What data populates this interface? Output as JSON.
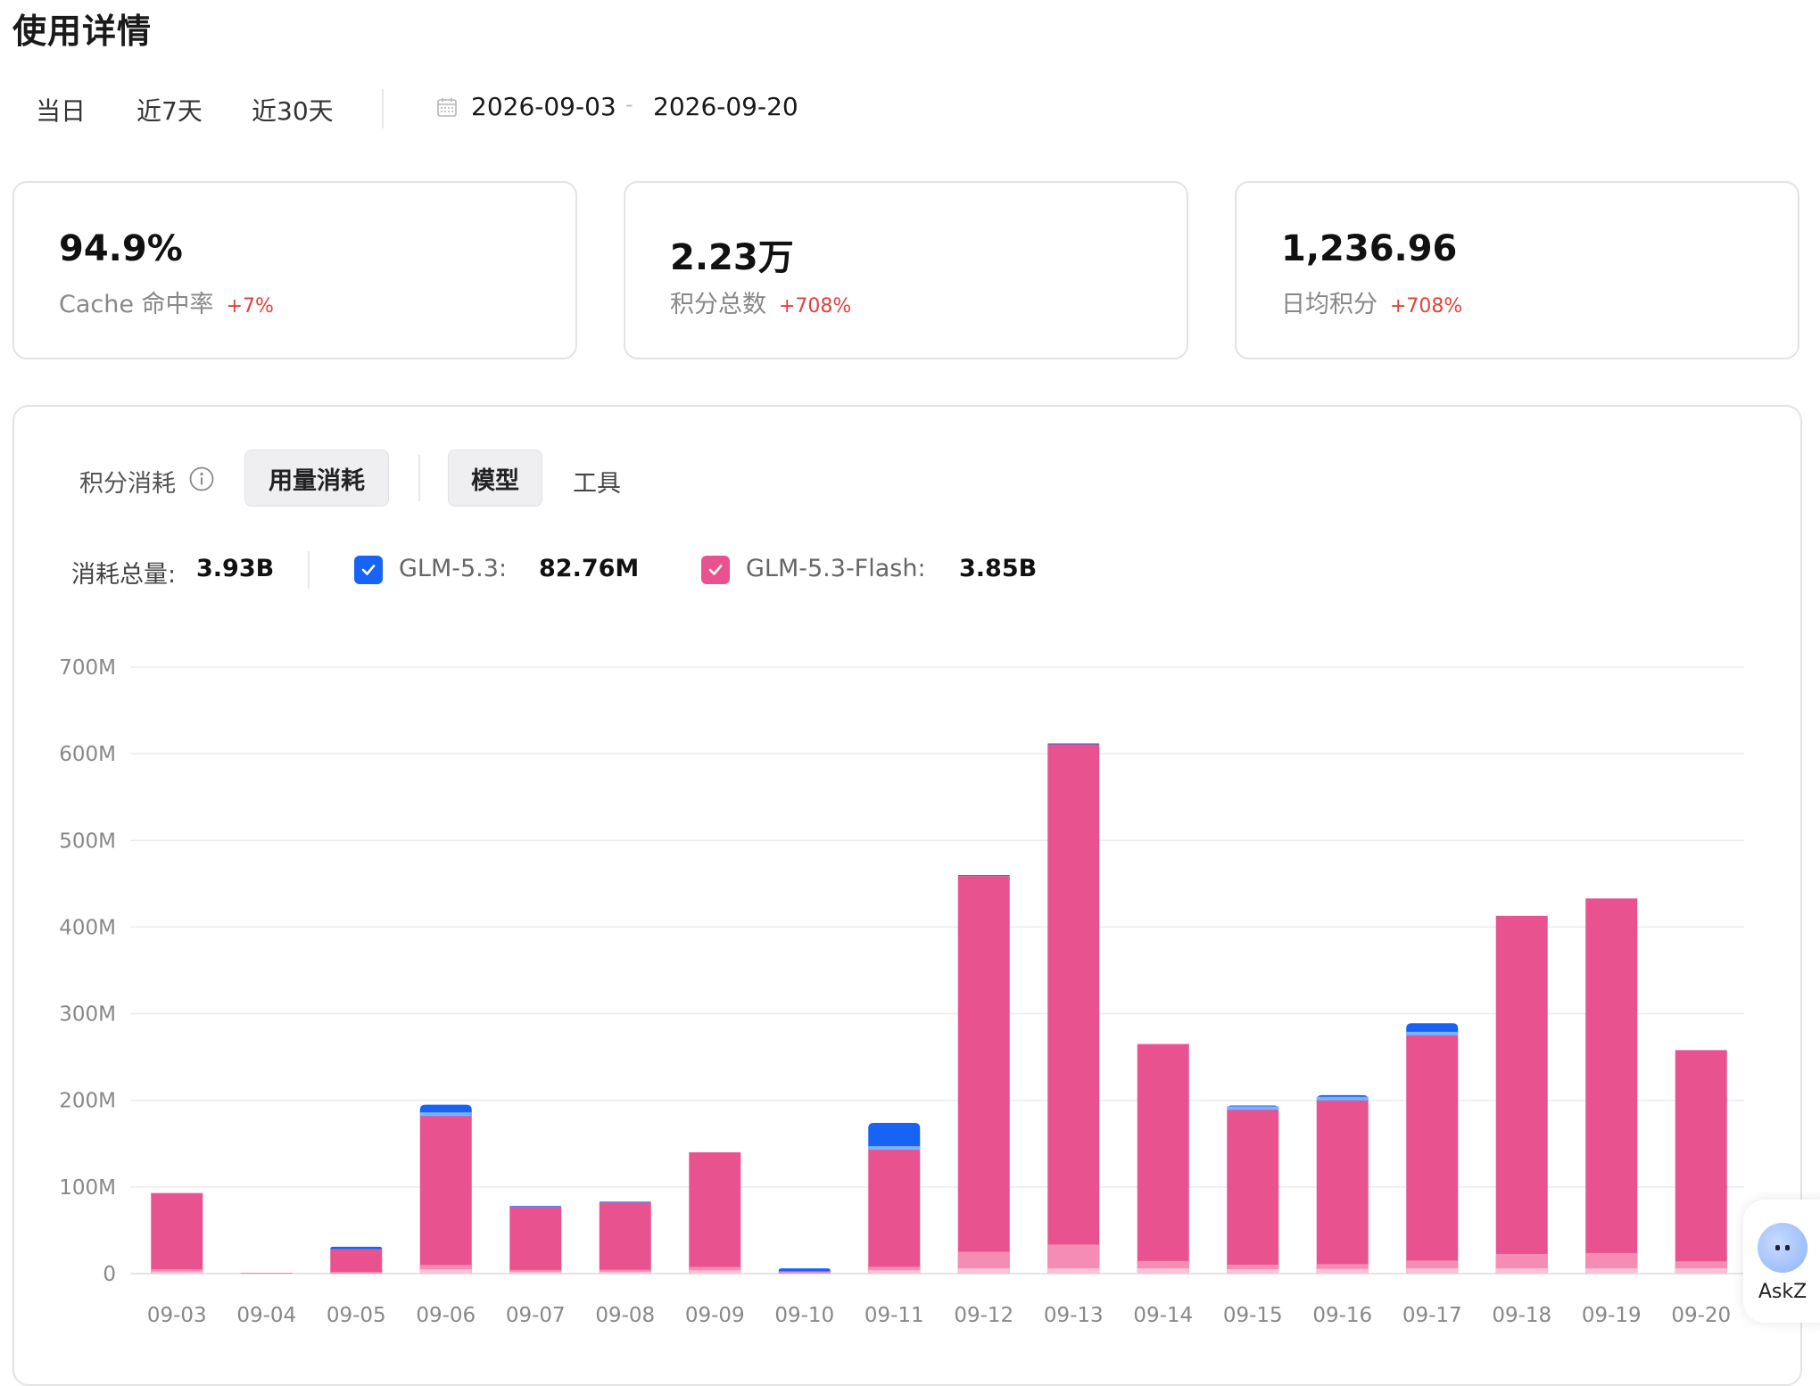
{
  "page": {
    "title": "使用详情"
  },
  "range": {
    "tabs": [
      "当日",
      "近7天",
      "近30天"
    ],
    "start": "2026-09-03",
    "separator": "-",
    "end": "2026-09-20"
  },
  "stats": [
    {
      "value": "94.9%",
      "label": "Cache 命中率",
      "change": "+7%"
    },
    {
      "value": "2.23万",
      "label": "积分总数",
      "change": "+708%"
    },
    {
      "value": "1,236.96",
      "label": "日均积分",
      "change": "+708%"
    }
  ],
  "panel": {
    "points_label": "积分消耗",
    "usage_btn": "用量消耗",
    "model_btn": "模型",
    "tool_tab": "工具"
  },
  "summary": {
    "total_label": "消耗总量:",
    "total_value": "3.93B",
    "series": [
      {
        "name": "GLM-5.3:",
        "value": "82.76M",
        "checked": true,
        "color": "#1763f5"
      },
      {
        "name": "GLM-5.3-Flash:",
        "value": "3.85B",
        "checked": true,
        "color": "#e8538f"
      }
    ]
  },
  "chart_data": {
    "type": "bar",
    "stacked": true,
    "categories": [
      "09-03",
      "09-04",
      "09-05",
      "09-06",
      "09-07",
      "09-08",
      "09-09",
      "09-10",
      "09-11",
      "09-12",
      "09-13",
      "09-14",
      "09-15",
      "09-16",
      "09-17",
      "09-18",
      "09-19",
      "09-20"
    ],
    "y_ticks": [
      "0",
      "100M",
      "200M",
      "300M",
      "400M",
      "500M",
      "600M",
      "700M"
    ],
    "ylim": [
      0,
      700
    ],
    "unit": "M",
    "grid": true,
    "legend": "top-left",
    "series": [
      {
        "name": "GLM-5.3-Flash",
        "color": "#e8538f",
        "values": [
          93,
          1,
          28,
          182,
          77,
          82,
          140,
          3,
          143,
          459,
          611,
          265,
          189,
          200,
          275,
          413,
          433,
          258
        ]
      },
      {
        "name": "GLM-5.3",
        "color": "#1763f5",
        "values": [
          0,
          0,
          3,
          13,
          1,
          1,
          0,
          3,
          31,
          1,
          1,
          0,
          5,
          6,
          14,
          0,
          0,
          0
        ]
      }
    ]
  },
  "assistant": {
    "label": "AskZ"
  }
}
